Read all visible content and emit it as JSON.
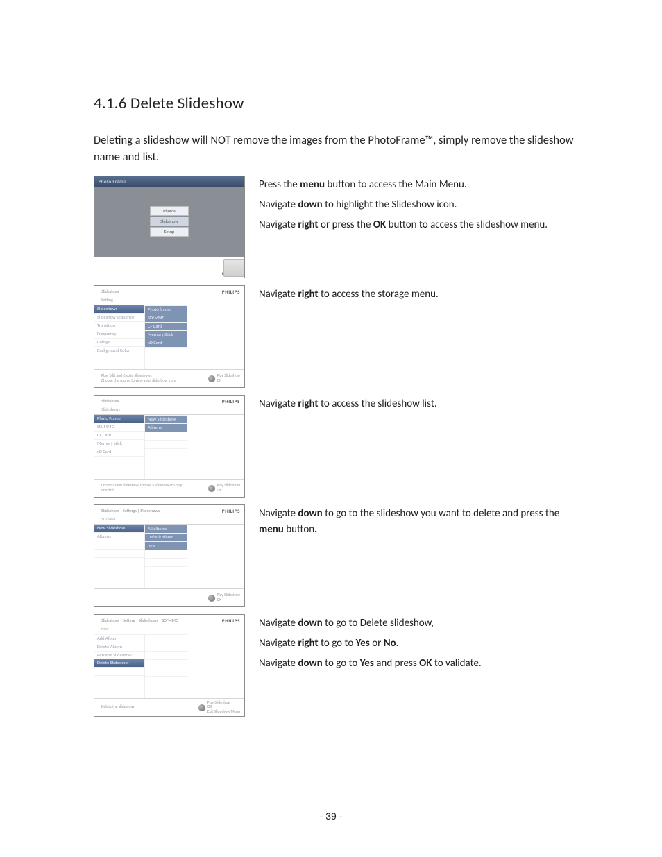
{
  "heading": "4.1.6  Delete Slideshow",
  "intro": "Deleting a slideshow will NOT remove the images from the PhotoFrame™, simply remove the slideshow name and list.",
  "brand": "PHILIPS",
  "page_number": "- 39 -",
  "step1": {
    "title": "Photo Frame",
    "menu": [
      "Photos",
      "Slideshow",
      "Setup"
    ],
    "lines": {
      "a": {
        "pre": "Press the ",
        "b": "menu",
        "post": " button to access the Main Menu."
      },
      "b": {
        "pre": "Navigate ",
        "b": "down",
        "post": " to highlight the Slideshow icon."
      },
      "c": {
        "pre": "Navigate ",
        "b1": "right",
        "mid": " or press the ",
        "b2": "OK",
        "post": " button to access the slideshow menu."
      }
    }
  },
  "step2": {
    "crumb": "Slideshow",
    "sub": "Setting",
    "left": [
      "Slideshows",
      "Slideshow sequence",
      "Transition",
      "Frequency",
      "Collage",
      "Background Color"
    ],
    "right": [
      "Photo frame",
      "SD/MMC",
      "CF Card",
      "Memory Stick",
      "xD Card",
      ""
    ],
    "hint1": "Play, Edit and Create Slideshows\nChoose the source to view your slideshow from",
    "hint2": "Play Slideshow\nOK",
    "instr": {
      "pre": "Navigate ",
      "b": "right",
      "post": " to access the storage menu."
    }
  },
  "step3": {
    "crumb": "Slideshow",
    "sub": "Slideshows",
    "left": [
      "Photo Frame",
      "SD/MMC",
      "CF Card",
      "Memory stick",
      "xD Card",
      ""
    ],
    "right": [
      "New Slideshow",
      "Albums",
      "",
      "",
      "",
      ""
    ],
    "hint1": "Create a new slideshow, choose a slideshow to play or edit it.",
    "hint2": "Play Slideshow\nOK",
    "instr": {
      "pre": "Navigate ",
      "b": "right",
      "post": " to access the slideshow list."
    }
  },
  "step4": {
    "crumb": "Slideshow | Settings | Slideshows",
    "sub": "SD/MMC",
    "left": [
      "New Slideshow",
      "Albums",
      "",
      "",
      "",
      ""
    ],
    "right": [
      "All albums",
      "Default album",
      "new",
      "",
      "",
      ""
    ],
    "hint1": "",
    "hint2": "Play Slideshow\nOK",
    "instr": {
      "a": {
        "pre": "Navigate ",
        "b": "down",
        "post": " to go to the slideshow you want to delete and press the "
      },
      "b": {
        "b": "menu",
        "post": " button"
      },
      "dot": "."
    }
  },
  "step5": {
    "crumb": "Slideshow | Setting | Slideshows | SD/MMC",
    "sub": "new",
    "left": [
      "Add Album",
      "Delete Album",
      "Rename Slideshow",
      "Delete Slideshow",
      "",
      ""
    ],
    "right": [
      "",
      "",
      "",
      "",
      "",
      ""
    ],
    "hint1": "Delete the slideshow",
    "hint2": "Play Slideshow\nOK\nExit Slideshow Menu",
    "lines": {
      "a": {
        "pre": "Navigate ",
        "b": "down",
        "post": " to go to Delete slideshow,"
      },
      "b": {
        "pre": "Navigate ",
        "b1": "right",
        "mid": " to go to ",
        "b2": "Yes",
        "mid2": " or ",
        "b3": "No",
        "post": "."
      },
      "c": {
        "pre": "Navigate ",
        "b1": "down",
        "mid": " to go to ",
        "b2": "Yes",
        "mid2": " and press ",
        "b3": "OK",
        "post": " to validate."
      }
    }
  }
}
